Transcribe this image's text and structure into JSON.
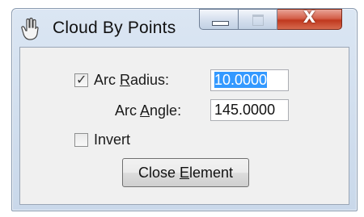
{
  "window": {
    "title": "Cloud By Points",
    "close_glyph": "X"
  },
  "icons": {
    "app": "hand-cursor-icon",
    "minimize": "minimize-icon",
    "maximize": "maximize-icon",
    "close": "close-icon",
    "check": "checkmark-icon"
  },
  "form": {
    "arc_radius": {
      "label_pre": "Arc ",
      "label_mnemonic": "R",
      "label_post": "adius:",
      "checked": true,
      "check_glyph": "✓",
      "value": "10.0000",
      "value_selected": true
    },
    "arc_angle": {
      "label_pre": "Arc ",
      "label_mnemonic": "A",
      "label_post": "ngle:",
      "value": "145.0000"
    },
    "invert": {
      "label": "Invert",
      "checked": false
    },
    "close_element": {
      "label_pre": "Close ",
      "label_mnemonic": "E",
      "label_post": "lement"
    }
  },
  "colors": {
    "selection": "#3399ff",
    "close_button": "#c0381e"
  }
}
